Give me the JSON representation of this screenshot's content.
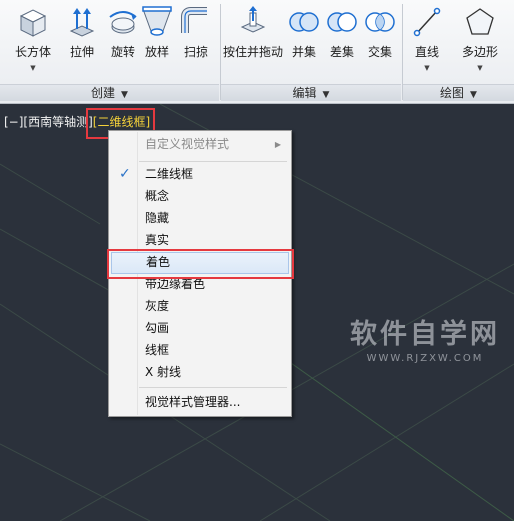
{
  "ribbon": {
    "create": {
      "box": "长方体",
      "extrude": "拉伸",
      "revolve": "旋转",
      "loft": "放样",
      "sweep": "扫掠",
      "panel_title": "创建"
    },
    "edit": {
      "presspull": "按住并拖动",
      "union": "并集",
      "subtract": "差集",
      "intersect": "交集",
      "panel_title": "编辑"
    },
    "draw": {
      "line": "直线",
      "polygon": "多边形",
      "panel_title": "绘图"
    },
    "dropdown_glyph": "▼"
  },
  "viewport": {
    "control_bracket": "[−]",
    "view_label": "[西南等轴测]",
    "visual_style_label": "[二维线框]"
  },
  "context_menu": {
    "items": [
      {
        "label": "自定义视觉样式",
        "state": "disabled",
        "submenu_glyph": "▶"
      },
      {
        "label": "二维线框",
        "check_glyph": "✓"
      },
      {
        "label": "概念"
      },
      {
        "label": "隐藏"
      },
      {
        "label": "真实"
      },
      {
        "label": "着色"
      },
      {
        "label": "带边缘着色"
      },
      {
        "label": "灰度"
      },
      {
        "label": "勾画"
      },
      {
        "label": "线框"
      },
      {
        "label": "X 射线"
      },
      {
        "label": "视觉样式管理器..."
      }
    ],
    "selected_index": 5,
    "checked_index": 1
  },
  "watermark": {
    "name": "软件自学网",
    "url": "WWW.RJZXW.COM"
  },
  "colors": {
    "viewport_background": "#2b313b",
    "visual_style_text": "#f5d23a",
    "highlight_box": "#e5393f",
    "grid_line": "#3e4f4a",
    "check_mark": "#2a72c7"
  }
}
